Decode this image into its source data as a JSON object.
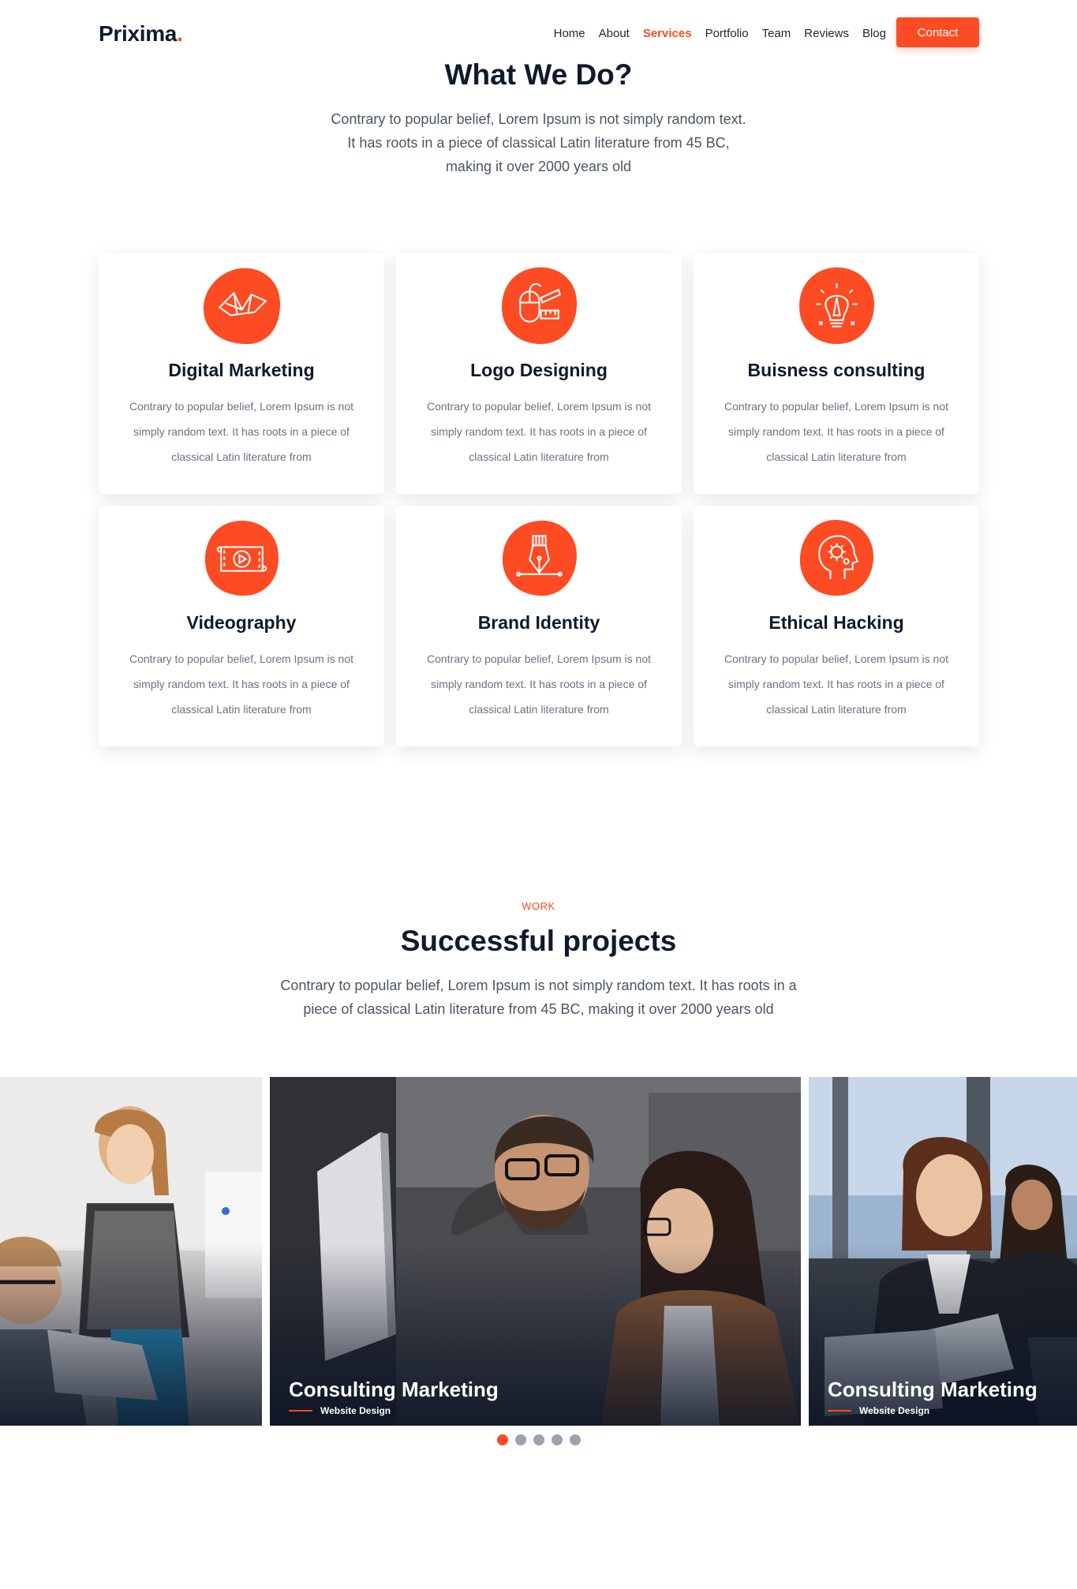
{
  "brand": {
    "name": "Prixima",
    "dot": "."
  },
  "nav": {
    "items": [
      "Home",
      "About",
      "Services",
      "Portfolio",
      "Team",
      "Reviews",
      "Blog"
    ],
    "active": "Services",
    "contact_label": "Contact"
  },
  "services": {
    "title": "What We Do?",
    "text": "Contrary to popular belief, Lorem Ipsum is not simply random text. It has roots in a piece of classical Latin literature from 45 BC, making it over 2000 years old",
    "cards": [
      {
        "icon": "origami-crane-icon",
        "title": "Digital Marketing",
        "text": "Contrary to popular belief, Lorem Ipsum is not simply random text. It has roots in a piece of classical Latin literature from"
      },
      {
        "icon": "mouse-pen-tools-icon",
        "title": "Logo Designing",
        "text": "Contrary to popular belief, Lorem Ipsum is not simply random text. It has roots in a piece of classical Latin literature from"
      },
      {
        "icon": "lightbulb-pencil-icon",
        "title": "Buisness consulting",
        "text": "Contrary to popular belief, Lorem Ipsum is not simply random text. It has roots in a piece of classical Latin literature from"
      },
      {
        "icon": "video-reel-icon",
        "title": "Videography",
        "text": "Contrary to popular belief, Lorem Ipsum is not simply random text. It has roots in a piece of classical Latin literature from"
      },
      {
        "icon": "pen-nib-icon",
        "title": "Brand Identity",
        "text": "Contrary to popular belief, Lorem Ipsum is not simply random text. It has roots in a piece of classical Latin literature from"
      },
      {
        "icon": "head-gear-icon",
        "title": "Ethical Hacking",
        "text": "Contrary to popular belief, Lorem Ipsum is not simply random text. It has roots in a piece of classical Latin literature from"
      }
    ]
  },
  "projects": {
    "eyebrow": "WORK",
    "title": "Successful projects",
    "text": "Contrary to popular belief, Lorem Ipsum is not simply random text. It has roots in a piece of classical Latin literature from 45 BC, making it over 2000 years old",
    "slides": [
      {
        "title": "",
        "category": ""
      },
      {
        "title": "Consulting Marketing",
        "category": "Website Design"
      },
      {
        "title": "Consulting Marketing",
        "category": "Website Design"
      }
    ],
    "dots": 5,
    "active_dot": 0
  },
  "colors": {
    "accent": "#fd4b23",
    "heading": "#0e1b2c",
    "body_text": "#6b7280"
  }
}
